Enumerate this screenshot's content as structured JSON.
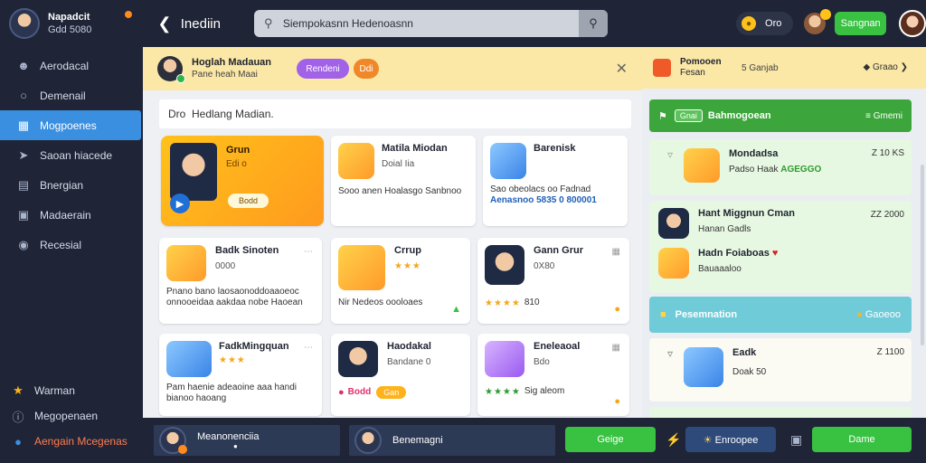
{
  "sidebar": {
    "profile": {
      "name": "Napadcit",
      "handle": "Gdd 5080"
    },
    "items": [
      {
        "label": "Aerodacal",
        "icon": "person-icon"
      },
      {
        "label": "Demenail",
        "icon": "chat-icon"
      },
      {
        "label": "Mogpoenes",
        "icon": "calendar-icon",
        "active": true
      },
      {
        "label": "Saoan hiacede",
        "icon": "rocket-icon"
      },
      {
        "label": "Bnergian",
        "icon": "bars-icon"
      },
      {
        "label": "Madaerain",
        "icon": "bag-icon"
      },
      {
        "label": "Recesial",
        "icon": "people-icon"
      }
    ],
    "bottom": [
      {
        "label": "Warman",
        "icon": "star-icon"
      },
      {
        "label": "Megopenaen",
        "icon": "help-icon"
      },
      {
        "label": "Aengain Mcegenas",
        "icon": "logout-icon"
      }
    ]
  },
  "topbar": {
    "title": "Inediin",
    "search_value": "Siempokasnn Hedenoasnn",
    "coins": "Oro",
    "button": "Sangnan"
  },
  "notice": {
    "title": "Hoglah Madauan",
    "subtitle": "Pane heah Maai",
    "pill1": "Rendeni",
    "pill2": "Ddi"
  },
  "main_input": "Dro  Hedlang Madian.",
  "feature_card": {
    "title": "Grun",
    "sub": "Edi o",
    "tag": "Bodd"
  },
  "cards": [
    {
      "title": "Matila Miodan",
      "sub": "Doial Iia",
      "desc": "Sooo anen Hoalasgo Sanbnoo"
    },
    {
      "title": "Barenisk",
      "sub": "",
      "desc": "Sao obeolacs oo Fadnad",
      "desc2": "Aenasnoo 5835 0 800001"
    },
    {
      "title": "Badk Sinoten",
      "sub": "0000",
      "desc": "Pnano bano laosaonoddoaaoeoc onnooeidaa aakdaa nobe Haoean",
      "desc2": ""
    },
    {
      "title": "Crrup",
      "sub": "",
      "desc": "Nir Nedeos oooloaes"
    },
    {
      "title": "Gann Grur",
      "sub": "0X80",
      "desc": "810"
    },
    {
      "title": "FadkMingquan",
      "sub": "",
      "desc": "Pam haenie adeaoine aaa handi bianoo haoang"
    },
    {
      "title": "Haodakal",
      "sub": "Bandane 0",
      "tag": "Gan",
      "tag_pre": "Bodd"
    },
    {
      "title": "Eneleaoal",
      "sub": "Bdo",
      "desc": "Sig aleom"
    }
  ],
  "rpanel": {
    "head_title": "Pomooen",
    "head_sub": "Fesan",
    "head_mid": "5 Ganjab",
    "head_right": "Graao",
    "green_bar": {
      "pill": "Gnai",
      "title": "Bahmogoean",
      "right": "Gmemi"
    },
    "items": [
      {
        "title": "Mondadsa",
        "sub": "Padso Haak",
        "hl": "AGEGGO",
        "num": "Z 10 KS"
      },
      {
        "title": "Hant Miggnun Cman",
        "sub": "Hanan Gadls",
        "num": "ZZ 2000"
      },
      {
        "title": "Hadn Foiaboas",
        "sub": "Bauaaaloo",
        "num": ""
      },
      {
        "title": "Eadk",
        "sub": "Doak 50",
        "num": "Z 1100"
      }
    ],
    "blue_bar": {
      "title": "Pesemnation",
      "right": "Gaoeoo"
    }
  },
  "bottombar": {
    "user1": "Meanonenciia",
    "user2": "Benemagni",
    "btn_green1": "Geige",
    "btn_blue": "Enroopee",
    "btn_green2": "Dame"
  }
}
